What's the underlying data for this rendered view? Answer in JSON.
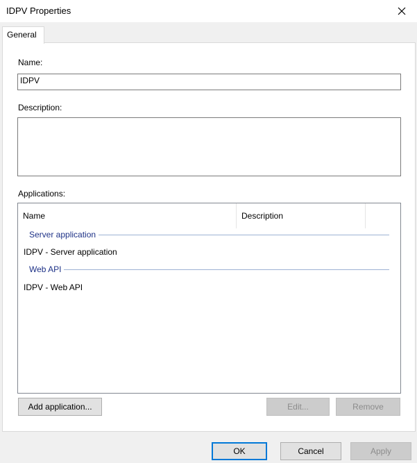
{
  "window": {
    "title": "IDPV Properties"
  },
  "tabs": [
    {
      "label": "General"
    }
  ],
  "form": {
    "name_label": "Name:",
    "name_value": "IDPV",
    "description_label": "Description:",
    "description_value": "",
    "applications_label": "Applications:"
  },
  "applications": {
    "columns": [
      "Name",
      "Description"
    ],
    "groups": [
      {
        "label": "Server application",
        "items": [
          "IDPV - Server application"
        ]
      },
      {
        "label": "Web API",
        "items": [
          "IDPV - Web API"
        ]
      }
    ],
    "add_label": "Add application...",
    "edit_label": "Edit...",
    "remove_label": "Remove"
  },
  "footer": {
    "ok_label": "OK",
    "cancel_label": "Cancel",
    "apply_label": "Apply"
  },
  "icons": {
    "close": "close-icon"
  }
}
